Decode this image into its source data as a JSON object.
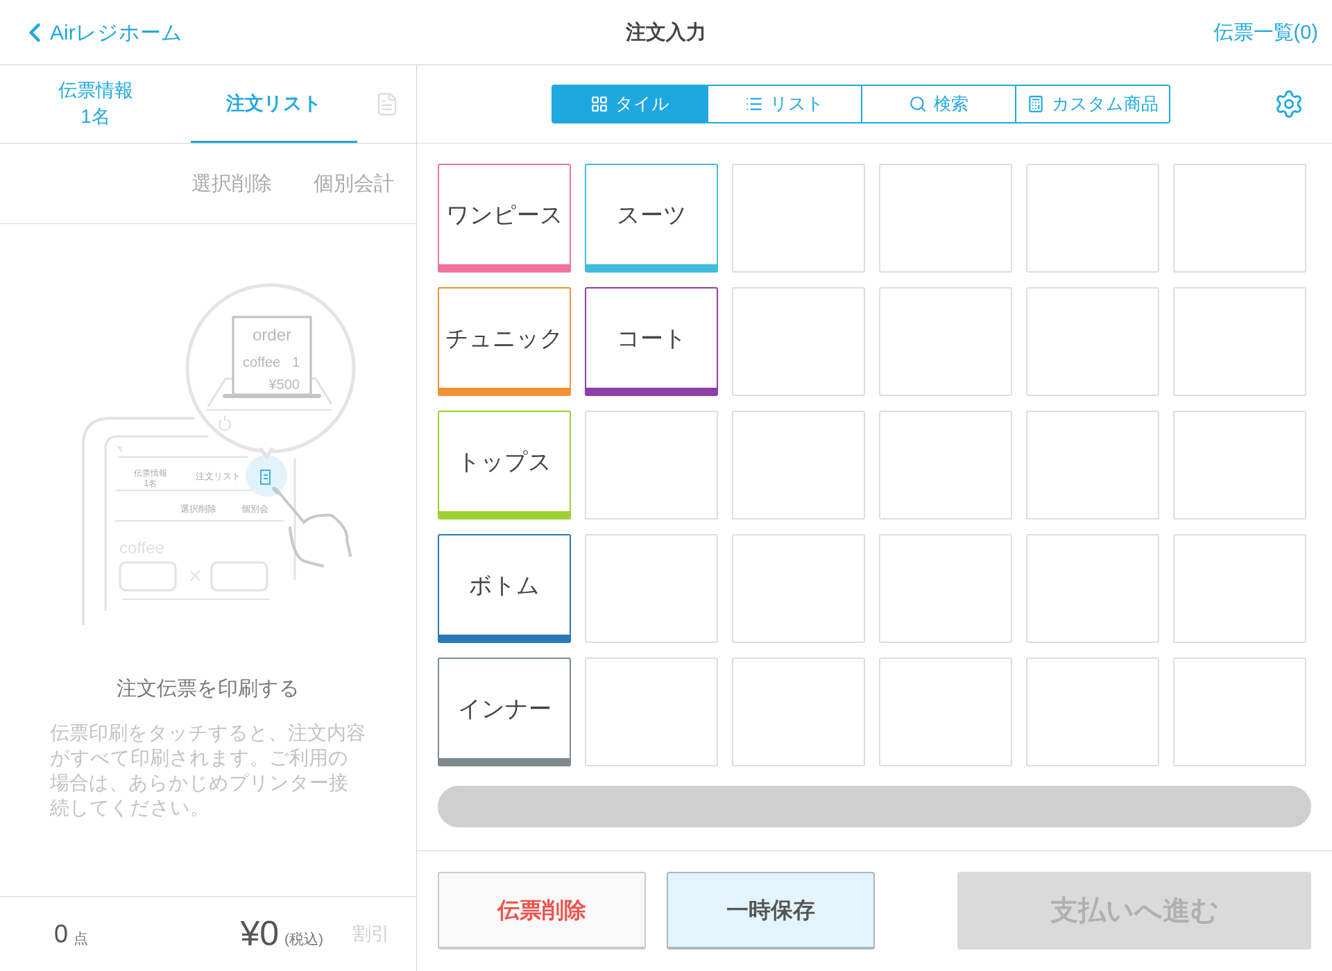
{
  "header": {
    "back": "Airレジホーム",
    "title": "注文入力",
    "slips": "伝票一覧(0)"
  },
  "left_tabs": [
    {
      "label": "伝票情報",
      "sub": "1名",
      "selected": false
    },
    {
      "label": "注文リスト",
      "selected": true
    }
  ],
  "actions": [
    "選択削除",
    "個別会計"
  ],
  "illustration": {
    "receipt": [
      "order",
      "coffee",
      "1",
      "¥500"
    ],
    "tabs": [
      "伝票情報",
      "1名",
      "注文リスト"
    ],
    "actions": [
      "選択削除",
      "個別会"
    ],
    "item": "coffee"
  },
  "empty_title": "注文伝票を印刷する",
  "empty_text": "伝票印刷をタッチすると、注文内容がすべて印刷されます。ご利用の場合は、あらかじめプリンター接続してください。",
  "footer": {
    "count": "0",
    "count_unit": "点",
    "total": "¥0",
    "tax": "(税込)",
    "discount": "割引"
  },
  "view_tabs": [
    {
      "kind": "tile",
      "label": "タイル",
      "selected": true
    },
    {
      "kind": "list",
      "label": "リスト",
      "selected": false
    },
    {
      "kind": "search",
      "label": "検索",
      "selected": false
    },
    {
      "kind": "custom",
      "label": "カスタム商品",
      "selected": false
    }
  ],
  "tiles": [
    {
      "label": "ワンピース",
      "color": "#f0739d"
    },
    {
      "label": "スーツ",
      "color": "#3ebde0"
    },
    {
      "kind": "empty"
    },
    {
      "kind": "empty"
    },
    {
      "kind": "empty"
    },
    {
      "kind": "empty"
    },
    {
      "label": "チュニック",
      "color": "#f39234"
    },
    {
      "label": "コート",
      "color": "#8e3fa8"
    },
    {
      "kind": "empty"
    },
    {
      "kind": "empty"
    },
    {
      "kind": "empty"
    },
    {
      "kind": "empty"
    },
    {
      "label": "トップス",
      "color": "#9bd22f"
    },
    {
      "kind": "empty"
    },
    {
      "kind": "empty"
    },
    {
      "kind": "empty"
    },
    {
      "kind": "empty"
    },
    {
      "kind": "empty"
    },
    {
      "label": "ボトム",
      "color": "#2a78b8"
    },
    {
      "kind": "empty"
    },
    {
      "kind": "empty"
    },
    {
      "kind": "empty"
    },
    {
      "kind": "empty"
    },
    {
      "kind": "empty"
    },
    {
      "label": "インナー",
      "color": "#7f8a8f"
    },
    {
      "kind": "empty"
    },
    {
      "kind": "empty"
    },
    {
      "kind": "empty"
    },
    {
      "kind": "empty"
    },
    {
      "kind": "empty"
    }
  ],
  "buttons": [
    {
      "kind": "danger",
      "label": "伝票削除",
      "disabled": false
    },
    {
      "kind": "save",
      "label": "一時保存",
      "disabled": false
    },
    {
      "kind": "primary",
      "label": "支払いへ進む",
      "disabled": true
    }
  ]
}
